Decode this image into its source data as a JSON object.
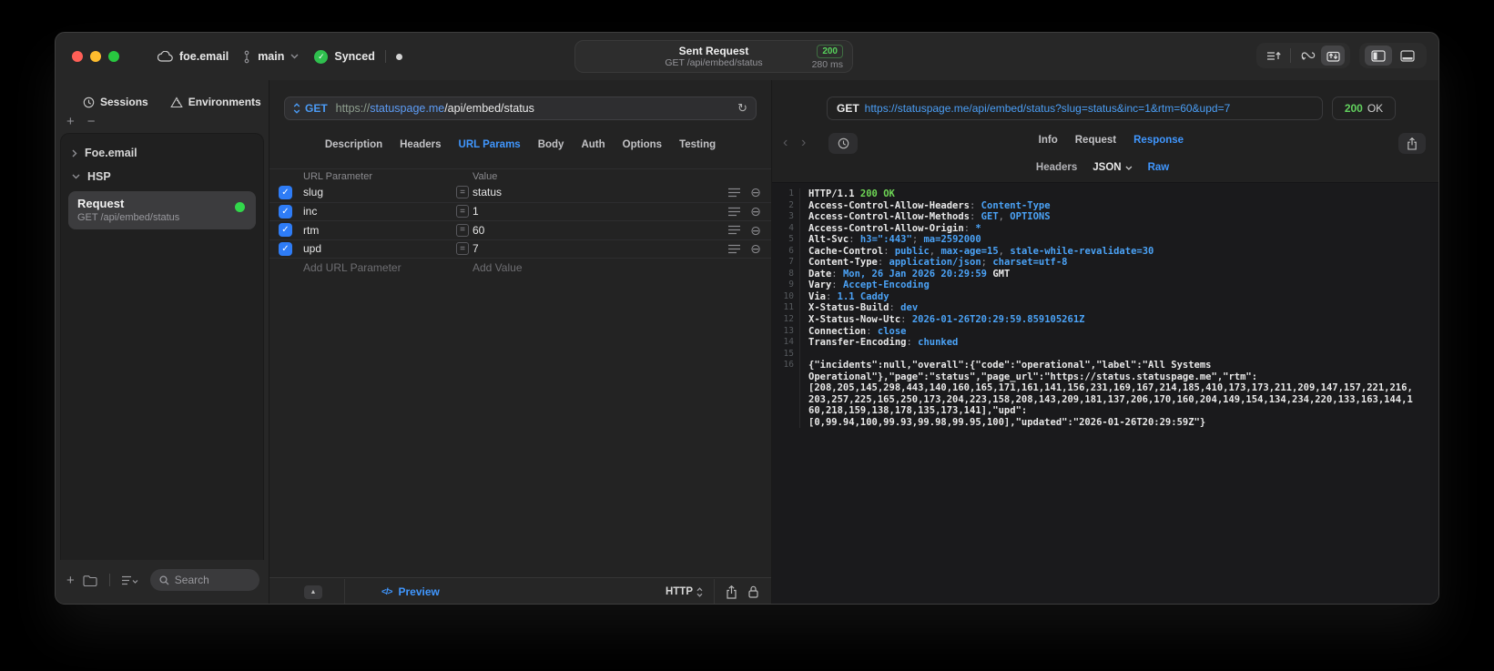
{
  "icons": {
    "check": "✓",
    "plus": "+",
    "minus": "−",
    "equals": "=",
    "minus_circle": "⊖",
    "triangle_up": "▲",
    "back": "‹",
    "forward": "›",
    "refresh": "↻",
    "dot": "●",
    "code": "</>"
  },
  "titlebar": {
    "workspace": "foe.email",
    "branch": "main",
    "sync_label": "Synced",
    "center": {
      "title": "Sent Request",
      "subtitle": "GET /api/embed/status",
      "status_code": "200",
      "duration": "280 ms"
    }
  },
  "sidebar": {
    "tabs": [
      {
        "label": "Sessions"
      },
      {
        "label": "Environments"
      }
    ],
    "tree": [
      {
        "label": "Foe.email"
      },
      {
        "label": "HSP"
      }
    ],
    "request_item": {
      "title": "Request",
      "subtitle": "GET /api/embed/status"
    },
    "search_placeholder": "Search"
  },
  "request": {
    "method": "GET",
    "url": {
      "scheme": "https://",
      "host": "statuspage.me",
      "path": "/api/embed/status"
    },
    "tabs": [
      "Description",
      "Headers",
      "URL Params",
      "Body",
      "Auth",
      "Options",
      "Testing"
    ],
    "active_tab": "URL Params",
    "table": {
      "param_header": "URL Parameter",
      "value_header": "Value",
      "rows": [
        {
          "enabled": true,
          "name": "slug",
          "op": "=",
          "value": "status"
        },
        {
          "enabled": true,
          "name": "inc",
          "op": "=",
          "value": "1"
        },
        {
          "enabled": true,
          "name": "rtm",
          "op": "=",
          "value": "60"
        },
        {
          "enabled": true,
          "name": "upd",
          "op": "=",
          "value": "7"
        }
      ],
      "add_param_label": "Add URL Parameter",
      "add_value_label": "Add Value"
    },
    "footer": {
      "preview_label": "Preview",
      "protocol": "HTTP"
    }
  },
  "response": {
    "method": "GET",
    "url": "https://statuspage.me/api/embed/status?slug=status&inc=1&rtm=60&upd=7",
    "status_code": "200",
    "status_text": "OK",
    "tabs": [
      "Info",
      "Request",
      "Response"
    ],
    "active_tab": "Response",
    "subtabs": [
      "Headers",
      "JSON",
      "Raw"
    ],
    "active_subtab": "Raw",
    "code": [
      {
        "n": "1",
        "parts": [
          [
            "HTTP/1.1 ",
            "k"
          ],
          [
            "200 OK",
            "g"
          ]
        ]
      },
      {
        "n": "2",
        "parts": [
          [
            "Access-Control-Allow-Headers",
            "k"
          ],
          [
            ": ",
            "p"
          ],
          [
            "Content-Type",
            "v"
          ]
        ]
      },
      {
        "n": "3",
        "parts": [
          [
            "Access-Control-Allow-Methods",
            "k"
          ],
          [
            ": ",
            "p"
          ],
          [
            "GET",
            "v"
          ],
          [
            ", ",
            "p"
          ],
          [
            "OPTIONS",
            "v"
          ]
        ]
      },
      {
        "n": "4",
        "parts": [
          [
            "Access-Control-Allow-Origin",
            "k"
          ],
          [
            ": ",
            "p"
          ],
          [
            "*",
            "v"
          ]
        ]
      },
      {
        "n": "5",
        "parts": [
          [
            "Alt-Svc",
            "k"
          ],
          [
            ": ",
            "p"
          ],
          [
            "h3=\":443\"",
            "v"
          ],
          [
            "; ",
            "p"
          ],
          [
            "ma=2592000",
            "v"
          ]
        ]
      },
      {
        "n": "6",
        "parts": [
          [
            "Cache-Control",
            "k"
          ],
          [
            ": ",
            "p"
          ],
          [
            "public",
            "v"
          ],
          [
            ", ",
            "p"
          ],
          [
            "max-age=15",
            "v"
          ],
          [
            ", ",
            "p"
          ],
          [
            "stale-while-revalidate=30",
            "v"
          ]
        ]
      },
      {
        "n": "7",
        "parts": [
          [
            "Content-Type",
            "k"
          ],
          [
            ": ",
            "p"
          ],
          [
            "application/json",
            "v"
          ],
          [
            "; ",
            "p"
          ],
          [
            "charset=utf-8",
            "v"
          ]
        ]
      },
      {
        "n": "8",
        "parts": [
          [
            "Date",
            "k"
          ],
          [
            ": ",
            "p"
          ],
          [
            "Mon, 26 Jan 2026 20:29:59 ",
            "v"
          ],
          [
            "GMT",
            "k"
          ]
        ]
      },
      {
        "n": "9",
        "parts": [
          [
            "Vary",
            "k"
          ],
          [
            ": ",
            "p"
          ],
          [
            "Accept-Encoding",
            "v"
          ]
        ]
      },
      {
        "n": "10",
        "parts": [
          [
            "Via",
            "k"
          ],
          [
            ": ",
            "p"
          ],
          [
            "1.1 Caddy",
            "v"
          ]
        ]
      },
      {
        "n": "11",
        "parts": [
          [
            "X-Status-Build",
            "k"
          ],
          [
            ": ",
            "p"
          ],
          [
            "dev",
            "v"
          ]
        ]
      },
      {
        "n": "12",
        "parts": [
          [
            "X-Status-Now-Utc",
            "k"
          ],
          [
            ": ",
            "p"
          ],
          [
            "2026-01-26T20:29:59.859105261Z",
            "v"
          ]
        ]
      },
      {
        "n": "13",
        "parts": [
          [
            "Connection",
            "k"
          ],
          [
            ": ",
            "p"
          ],
          [
            "close",
            "v"
          ]
        ]
      },
      {
        "n": "14",
        "parts": [
          [
            "Transfer-Encoding",
            "k"
          ],
          [
            ": ",
            "p"
          ],
          [
            "chunked",
            "v"
          ]
        ]
      },
      {
        "n": "15",
        "parts": []
      },
      {
        "n": "16",
        "parts": [
          [
            "{\"incidents\":null,\"overall\":{\"code\":\"operational\",\"label\":\"All Systems",
            "t"
          ]
        ]
      },
      {
        "n": "",
        "parts": [
          [
            "Operational\"},\"page\":\"status\",\"page_url\":\"https://status.statuspage.me\",\"rtm\":",
            "t"
          ]
        ]
      },
      {
        "n": "",
        "parts": [
          [
            "[208,205,145,298,443,140,160,165,171,161,141,156,231,169,167,214,185,410,173,173,211,209,147,157,221,216,",
            "t"
          ]
        ]
      },
      {
        "n": "",
        "parts": [
          [
            "203,257,225,165,250,173,204,223,158,208,143,209,181,137,206,170,160,204,149,154,134,234,220,133,163,144,1",
            "t"
          ]
        ]
      },
      {
        "n": "",
        "parts": [
          [
            "60,218,159,138,178,135,173,141],\"upd\":",
            "t"
          ]
        ]
      },
      {
        "n": "",
        "parts": [
          [
            "[0,99.94,100,99.93,99.98,99.95,100],\"updated\":\"2026-01-26T20:29:59Z\"}",
            "t"
          ]
        ]
      }
    ]
  }
}
